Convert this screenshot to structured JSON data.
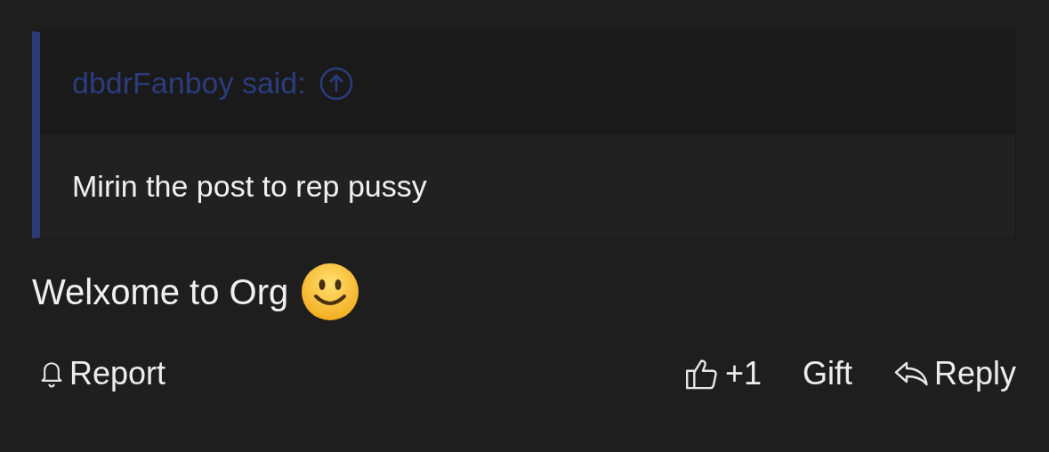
{
  "quote": {
    "author": "dbdrFanboy said:",
    "text": "Mirin the post to rep pussy"
  },
  "message": {
    "text": "Welxome to Org"
  },
  "actions": {
    "left": [
      {
        "label": "Report",
        "kind": "report"
      }
    ],
    "right": [
      {
        "label": "+1",
        "kind": "like"
      },
      {
        "label": "Gift",
        "kind": "gift"
      },
      {
        "label": "Reply",
        "kind": "reply"
      }
    ]
  }
}
